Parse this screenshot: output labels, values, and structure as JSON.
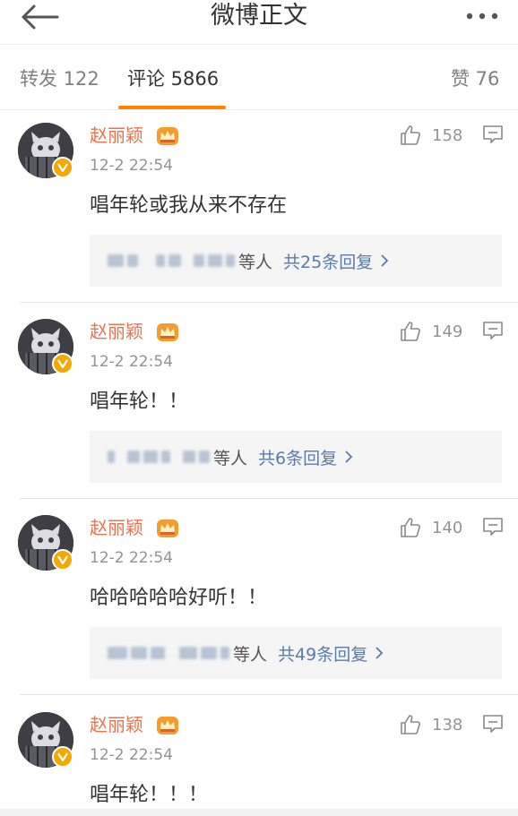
{
  "header": {
    "title": "微博正文"
  },
  "tabs": {
    "repost": "转发 122",
    "comment": "评论 5866",
    "like": "赞 76"
  },
  "comments": [
    {
      "username": "赵丽颖",
      "time": "12-2 22:54",
      "likes": "158",
      "text": "唱年轮或我从来不存在",
      "reply_suffix": "等人",
      "reply_count": "共25条回复"
    },
    {
      "username": "赵丽颖",
      "time": "12-2 22:54",
      "likes": "149",
      "text": "唱年轮！！",
      "reply_suffix": "等人",
      "reply_count": "共6条回复"
    },
    {
      "username": "赵丽颖",
      "time": "12-2 22:54",
      "likes": "140",
      "text": "哈哈哈哈哈好听！！",
      "reply_suffix": "等人",
      "reply_count": "共49条回复"
    },
    {
      "username": "赵丽颖",
      "time": "12-2 22:54",
      "likes": "138",
      "text": "唱年轮！！！"
    }
  ],
  "icons": {
    "back": "arrow-left-icon",
    "more": "more-dots-icon",
    "like": "thumbs-up-icon",
    "reply": "comment-bubble-icon",
    "verified": "verified-v-icon",
    "vip": "crown-icon"
  },
  "colors": {
    "accent": "#ff8200",
    "username": "#eb7350",
    "link": "#5b7ba8",
    "verified": "#f4a800"
  }
}
